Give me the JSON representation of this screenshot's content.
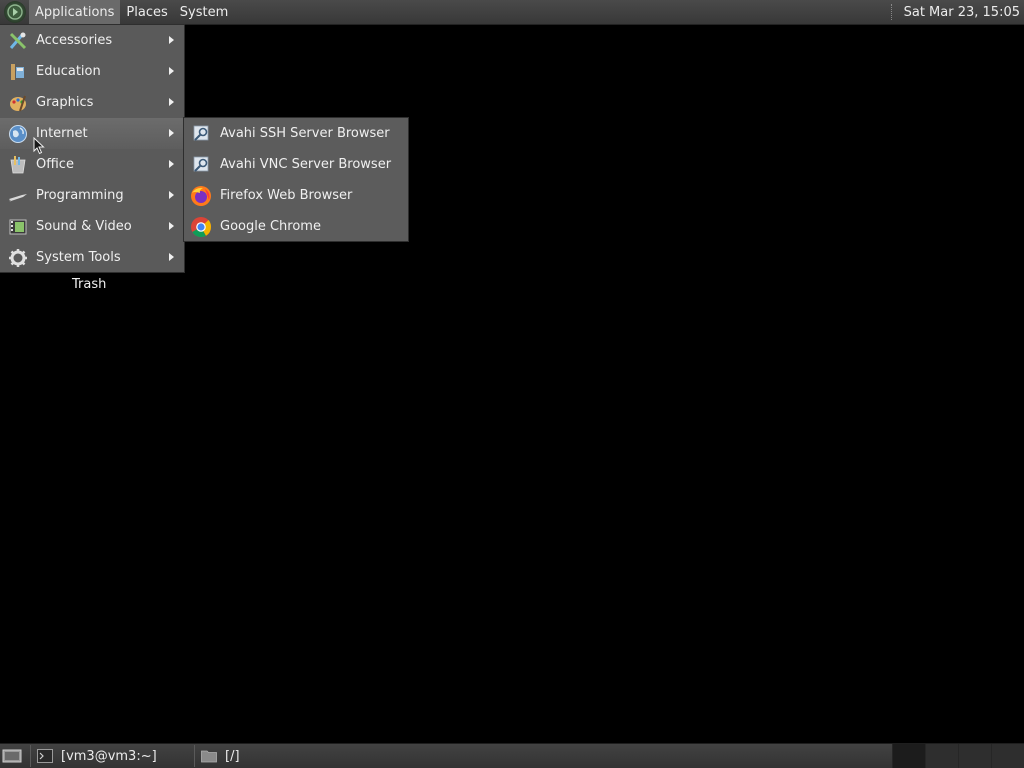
{
  "top_panel": {
    "menus": [
      "Applications",
      "Places",
      "System"
    ],
    "clock": "Sat Mar 23, 15:05"
  },
  "apps_menu": {
    "items": [
      {
        "label": "Accessories",
        "icon": "accessories-icon"
      },
      {
        "label": "Education",
        "icon": "education-icon"
      },
      {
        "label": "Graphics",
        "icon": "graphics-icon"
      },
      {
        "label": "Internet",
        "icon": "internet-icon"
      },
      {
        "label": "Office",
        "icon": "office-icon"
      },
      {
        "label": "Programming",
        "icon": "programming-icon"
      },
      {
        "label": "Sound & Video",
        "icon": "sound-video-icon"
      },
      {
        "label": "System Tools",
        "icon": "system-tools-icon"
      }
    ]
  },
  "internet_submenu": {
    "items": [
      {
        "label": "Avahi SSH Server Browser",
        "icon": "avahi-icon"
      },
      {
        "label": "Avahi VNC Server Browser",
        "icon": "avahi-icon"
      },
      {
        "label": "Firefox Web Browser",
        "icon": "firefox-icon"
      },
      {
        "label": "Google Chrome",
        "icon": "chrome-icon"
      }
    ]
  },
  "desktop": {
    "trash_label": "Trash"
  },
  "bottom_panel": {
    "tasks": [
      {
        "label": "[vm3@vm3:~]",
        "icon": "terminal-icon"
      },
      {
        "label": "[/]",
        "icon": "folder-icon"
      }
    ]
  }
}
